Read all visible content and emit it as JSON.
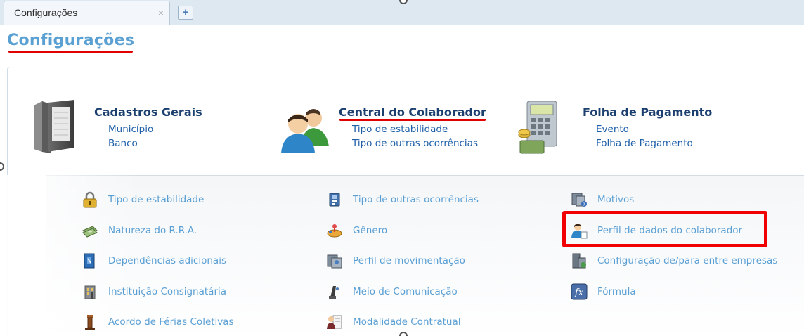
{
  "tab": {
    "label": "Configurações",
    "close": "×",
    "add": "+"
  },
  "page": {
    "title": "Configurações"
  },
  "categories": [
    {
      "title": "Cadastros Gerais",
      "links": [
        "Município",
        "Banco"
      ],
      "icon": "binders-icon"
    },
    {
      "title": "Central do Colaborador",
      "links": [
        "Tipo de estabilidade",
        "Tipo de outras ocorrências"
      ],
      "icon": "users-icon"
    },
    {
      "title": "Folha de Pagamento",
      "links": [
        "Evento",
        "Folha de Pagamento"
      ],
      "icon": "calculator-money-icon"
    }
  ],
  "items": {
    "col1": [
      "Tipo de estabilidade",
      "Natureza do R.R.A.",
      "Dependências adicionais",
      "Instituição Consignatária",
      "Acordo de Férias Coletivas"
    ],
    "col2": [
      "Tipo de outras ocorrências",
      "Gênero",
      "Perfil de movimentação",
      "Meio de Comunicação",
      "Modalidade Contratual"
    ],
    "col3": [
      "Motivos",
      "Perfil de dados do colaborador",
      "Configuração de/para entre empresas",
      "Fórmula"
    ]
  },
  "colors": {
    "accent": "#5aa0d2",
    "highlight": "#f00000",
    "link": "#1f5fa8",
    "heading": "#1b3f6e"
  }
}
